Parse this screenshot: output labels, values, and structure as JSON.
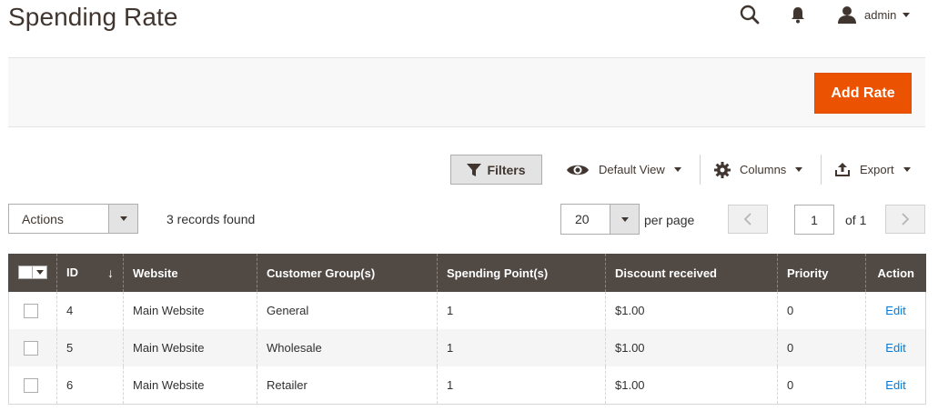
{
  "header": {
    "title": "Spending Rate",
    "user": "admin"
  },
  "action_bar": {
    "add_button": "Add Rate"
  },
  "toolbar": {
    "filters": "Filters",
    "view": "Default View",
    "columns": "Columns",
    "export": "Export"
  },
  "grid_controls": {
    "actions": "Actions",
    "records": "3 records found",
    "per_page_value": "20",
    "per_page_label": "per page",
    "page_current": "1",
    "page_total": "of 1"
  },
  "table": {
    "columns": [
      "ID",
      "Website",
      "Customer Group(s)",
      "Spending Point(s)",
      "Discount received",
      "Priority",
      "Action"
    ],
    "rows": [
      {
        "id": "4",
        "website": "Main Website",
        "group": "General",
        "points": "1",
        "discount": "$1.00",
        "priority": "0",
        "action": "Edit"
      },
      {
        "id": "5",
        "website": "Main Website",
        "group": "Wholesale",
        "points": "1",
        "discount": "$1.00",
        "priority": "0",
        "action": "Edit"
      },
      {
        "id": "6",
        "website": "Main Website",
        "group": "Retailer",
        "points": "1",
        "discount": "$1.00",
        "priority": "0",
        "action": "Edit"
      }
    ]
  },
  "colors": {
    "accent": "#eb5202",
    "table_header": "#514943",
    "link": "#007bdb"
  }
}
